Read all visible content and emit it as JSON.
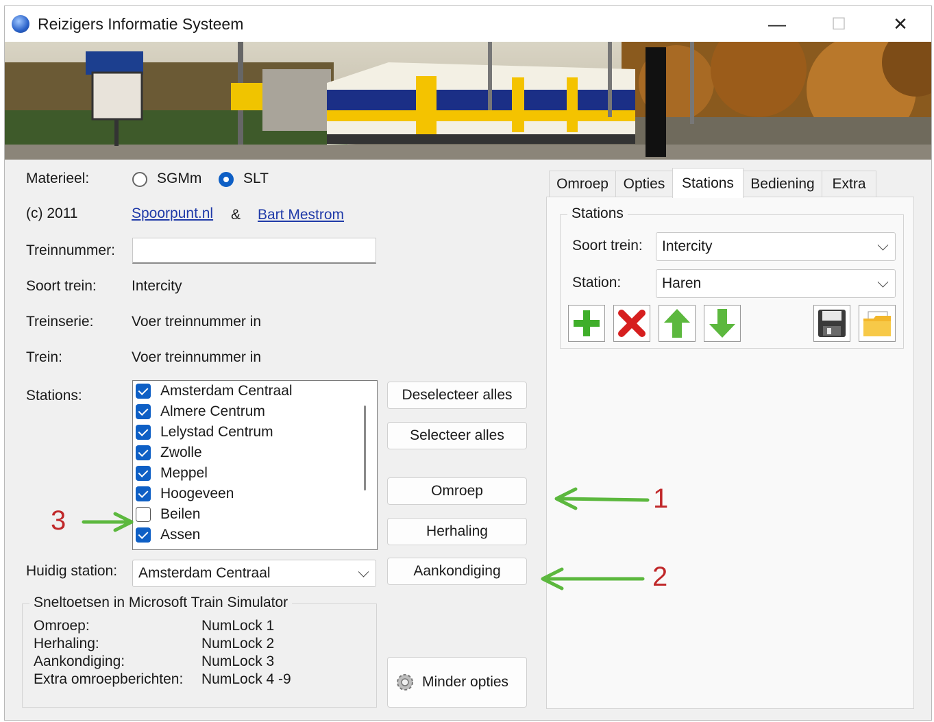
{
  "window": {
    "title": "Reizigers Informatie Systeem",
    "controls": {
      "minimize": "—",
      "maximize": "☐",
      "close": "✕"
    }
  },
  "left": {
    "materieel_label": "Materieel:",
    "materieel_options": [
      {
        "label": "SGMm",
        "selected": false
      },
      {
        "label": "SLT",
        "selected": true
      }
    ],
    "copyright": "(c) 2011",
    "link1": "Spoorpunt.nl",
    "amp": "&",
    "link2": "Bart Mestrom",
    "treinnummer_label": "Treinnummer:",
    "treinnummer_value": "",
    "soort_label": "Soort trein:",
    "soort_value": "Intercity",
    "treinserie_label": "Treinserie:",
    "treinserie_value": "Voer treinnummer in",
    "trein_label": "Trein:",
    "trein_value": "Voer treinnummer in",
    "stations_label": "Stations:",
    "stations": [
      {
        "name": "Amsterdam Centraal",
        "checked": true
      },
      {
        "name": "Almere Centrum",
        "checked": true
      },
      {
        "name": "Lelystad Centrum",
        "checked": true
      },
      {
        "name": "Zwolle",
        "checked": true
      },
      {
        "name": "Meppel",
        "checked": true
      },
      {
        "name": "Hoogeveen",
        "checked": true
      },
      {
        "name": "Beilen",
        "checked": false
      },
      {
        "name": "Assen",
        "checked": true
      }
    ],
    "huidig_label": "Huidig station:",
    "huidig_value": "Amsterdam Centraal"
  },
  "buttons": {
    "deselect": "Deselecteer alles",
    "select": "Selecteer alles",
    "omroep": "Omroep",
    "herhaling": "Herhaling",
    "aankondiging": "Aankondiging",
    "minder": "Minder opties"
  },
  "shortcuts": {
    "title": "Sneltoetsen in Microsoft Train Simulator",
    "rows": [
      {
        "name": "Omroep:",
        "key": "NumLock 1"
      },
      {
        "name": "Herhaling:",
        "key": "NumLock 2"
      },
      {
        "name": "Aankondiging:",
        "key": "NumLock 3"
      },
      {
        "name": "Extra omroepberichten:",
        "key": "NumLock 4 -9"
      }
    ]
  },
  "tabs": [
    {
      "label": "Omroep",
      "active": false
    },
    {
      "label": "Opties",
      "active": false
    },
    {
      "label": "Stations",
      "active": true
    },
    {
      "label": "Bediening",
      "active": false
    },
    {
      "label": "Extra",
      "active": false
    }
  ],
  "stations_panel": {
    "group_title": "Stations",
    "soort_label": "Soort trein:",
    "soort_value": "Intercity",
    "station_label": "Station:",
    "station_value": "Haren",
    "toolbar_icons": [
      "add-icon",
      "delete-icon",
      "move-up-icon",
      "move-down-icon",
      "save-icon",
      "open-folder-icon"
    ]
  },
  "annotations": {
    "one": "1",
    "two": "2",
    "three": "3"
  },
  "colors": {
    "accent": "#0e5fc5",
    "link": "#1f3aa8",
    "annotation_arrow": "#5cb83e",
    "annotation_number": "#c0282a"
  }
}
